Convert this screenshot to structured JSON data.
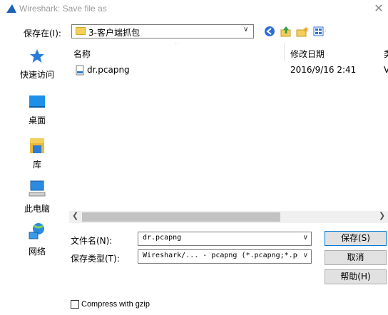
{
  "window": {
    "title": "Wireshark: Save file as",
    "close_glyph": "✕"
  },
  "toolbar": {
    "save_in_label": "保存在(I):",
    "location": "3-客户端抓包",
    "icons": [
      "back-icon",
      "up-folder-icon",
      "new-folder-icon",
      "view-menu-icon"
    ]
  },
  "sidebar": {
    "items": [
      {
        "label": "快速访问",
        "icon": "star-icon"
      },
      {
        "label": "桌面",
        "icon": "desktop-icon"
      },
      {
        "label": "库",
        "icon": "library-icon"
      },
      {
        "label": "此电脑",
        "icon": "computer-icon"
      },
      {
        "label": "网络",
        "icon": "network-icon"
      }
    ]
  },
  "filelist": {
    "columns": [
      "名称",
      "修改日期",
      "类"
    ],
    "rows": [
      {
        "name": "dr.pcapng",
        "modified": "2016/9/16 2:41",
        "type": "V"
      }
    ]
  },
  "form": {
    "filename_label": "文件名(N):",
    "filename_value": "dr.pcapng",
    "filetype_label": "保存类型(T):",
    "filetype_value": "Wireshark/... - pcapng (*.pcapng;*.pc",
    "save_button": "保存(S)",
    "cancel_button": "取消",
    "help_button": "帮助(H)"
  },
  "gzip": {
    "label": "Compress with gzip",
    "checked": false
  },
  "colors": {
    "accent": "#0078d7",
    "folder": "#f3cf5b",
    "shark_fin": "#1e63b5"
  }
}
